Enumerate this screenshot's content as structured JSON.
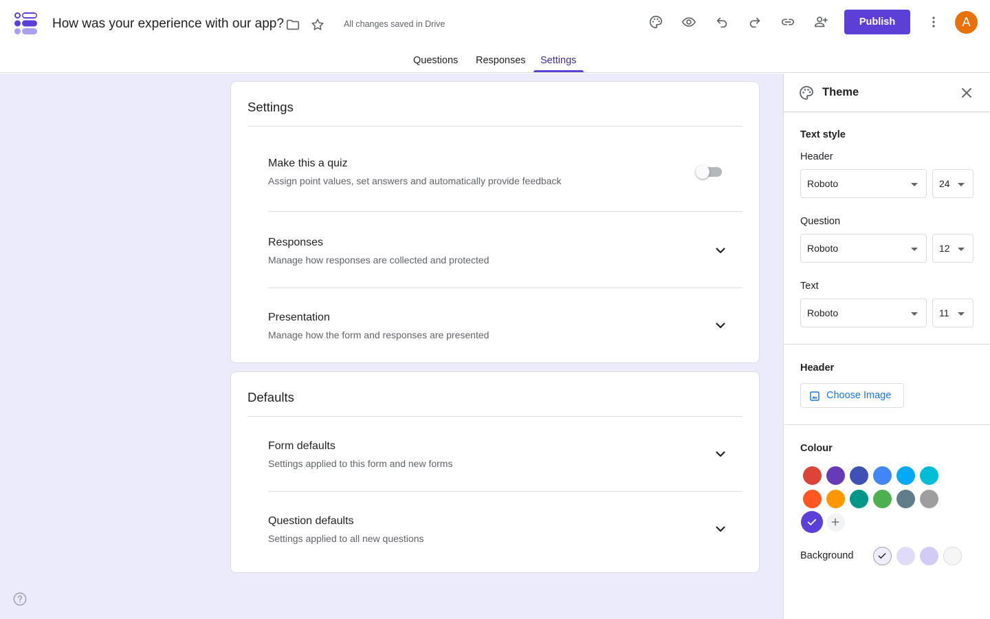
{
  "header": {
    "title": "How was your experience with our app?",
    "save_status": "All changes saved in Drive",
    "publish_label": "Publish",
    "avatar_letter": "A",
    "accent_color": "#5b3fd6"
  },
  "tabs": [
    {
      "label": "Questions",
      "active": false
    },
    {
      "label": "Responses",
      "active": false
    },
    {
      "label": "Settings",
      "active": true
    }
  ],
  "settings_card": {
    "title": "Settings",
    "rows": [
      {
        "title": "Make this a quiz",
        "subtitle": "Assign point values, set answers and automatically provide feedback",
        "control": "toggle",
        "toggle_on": false
      },
      {
        "title": "Responses",
        "subtitle": "Manage how responses are collected and protected",
        "control": "chevron-down-icon"
      },
      {
        "title": "Presentation",
        "subtitle": "Manage how the form and responses are presented",
        "control": "chevron-down-icon"
      }
    ]
  },
  "defaults_card": {
    "title": "Defaults",
    "rows": [
      {
        "title": "Form defaults",
        "subtitle": "Settings applied to this form and new forms",
        "control": "chevron-down-icon"
      },
      {
        "title": "Question defaults",
        "subtitle": "Settings applied to all new questions",
        "control": "chevron-down-icon"
      }
    ]
  },
  "theme_panel": {
    "title": "Theme",
    "text_style_label": "Text style",
    "fields": [
      {
        "label": "Header",
        "font": "Roboto",
        "size": "24"
      },
      {
        "label": "Question",
        "font": "Roboto",
        "size": "12"
      },
      {
        "label": "Text",
        "font": "Roboto",
        "size": "11"
      }
    ],
    "header_section_label": "Header",
    "choose_image_label": "Choose Image",
    "colour_label": "Colour",
    "colours": [
      "#db4437",
      "#673ab7",
      "#3f51b5",
      "#4285f4",
      "#03a9f4",
      "#00bcd4",
      "#ff5722",
      "#ff9800",
      "#009688",
      "#4caf50",
      "#607d8b",
      "#9e9e9e",
      "#5b3fd6"
    ],
    "selected_colour": "#5b3fd6",
    "background_label": "Background",
    "backgrounds": [
      "#efedfb",
      "#e0dcf8",
      "#d2cbf6",
      "#f6f6f6"
    ],
    "selected_background": "#efedfb"
  }
}
